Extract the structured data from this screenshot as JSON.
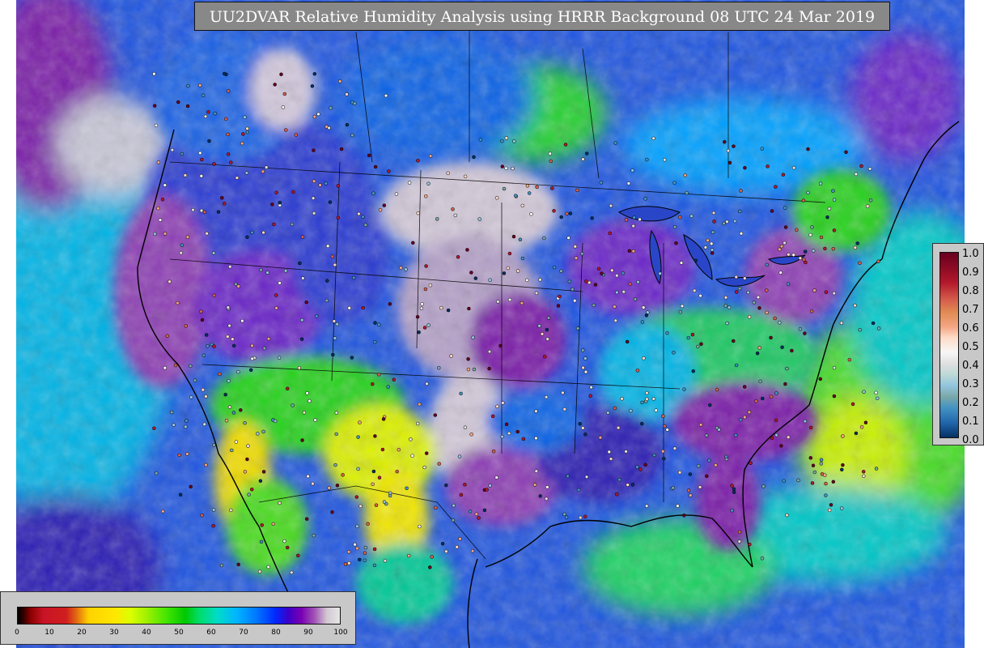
{
  "title": "UU2DVAR Relative Humidity Analysis using HRRR Background 08 UTC 24 Mar 2019",
  "right_colorbar": {
    "ticks": [
      "1.0",
      "0.9",
      "0.8",
      "0.7",
      "0.6",
      "0.5",
      "0.4",
      "0.3",
      "0.2",
      "0.1",
      "0.0"
    ],
    "colors": [
      "#67001f",
      "#b2182b",
      "#d6604d",
      "#f4a582",
      "#fddbc7",
      "#f7f7f7",
      "#e0e0e0",
      "#92c5de",
      "#7aa8a8",
      "#4393c3",
      "#053061"
    ]
  },
  "bottom_colorbar": {
    "ticks": [
      "0",
      "10",
      "20",
      "30",
      "40",
      "50",
      "60",
      "70",
      "80",
      "90",
      "100"
    ],
    "range": [
      0,
      100
    ],
    "colors": [
      "#000000",
      "#c81426",
      "#ffd200",
      "#a0f000",
      "#00c800",
      "#00dcc8",
      "#0078ff",
      "#3c00c8",
      "#a050b4",
      "#e6e6e6"
    ]
  },
  "map_colors": {
    "ocean": "#1e4be6",
    "ocean_dark": "#2a1fb4",
    "purple": "#7a1fa8",
    "dry_yellow": "#f0e600",
    "green": "#2ed21e",
    "cyan": "#00c8d2",
    "grey": "#c8c8d2"
  }
}
